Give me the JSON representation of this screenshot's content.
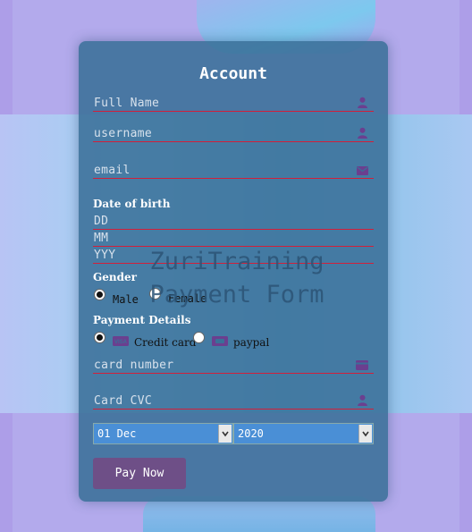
{
  "form": {
    "title": "Account",
    "fields": {
      "full_name": {
        "placeholder": "Full Name",
        "icon": "user-icon"
      },
      "username": {
        "placeholder": "username",
        "icon": "user-icon"
      },
      "email": {
        "placeholder": "email",
        "icon": "envelope-icon"
      },
      "card_number": {
        "placeholder": "card number",
        "icon": "credit-card-icon"
      },
      "card_cvc": {
        "placeholder": "Card CVC",
        "icon": "user-icon"
      }
    },
    "dob": {
      "label": "Date of birth",
      "day_placeholder": "DD",
      "month_placeholder": "MM",
      "year_placeholder": "YYY"
    },
    "gender": {
      "label": "Gender",
      "options": [
        "Male",
        "Female"
      ],
      "selected": "Male"
    },
    "payment": {
      "label": "Payment Details",
      "options": [
        {
          "label": "Credit card",
          "icon": "visa-icon"
        },
        {
          "label": "paypal",
          "icon": "paypal-icon"
        }
      ],
      "selected": "Credit card"
    },
    "expiry": {
      "month_value": "01 Dec",
      "year_value": "2020"
    },
    "pay_button": "Pay Now"
  },
  "watermark": {
    "line1": "ZuriTraining",
    "line2": "Payment Form"
  },
  "colors": {
    "card_bg": "#3a7098",
    "underline": "#d21f3a",
    "button": "#6e4f87",
    "select_bg": "#4a8fd6",
    "icon": "#6b3f8f"
  }
}
